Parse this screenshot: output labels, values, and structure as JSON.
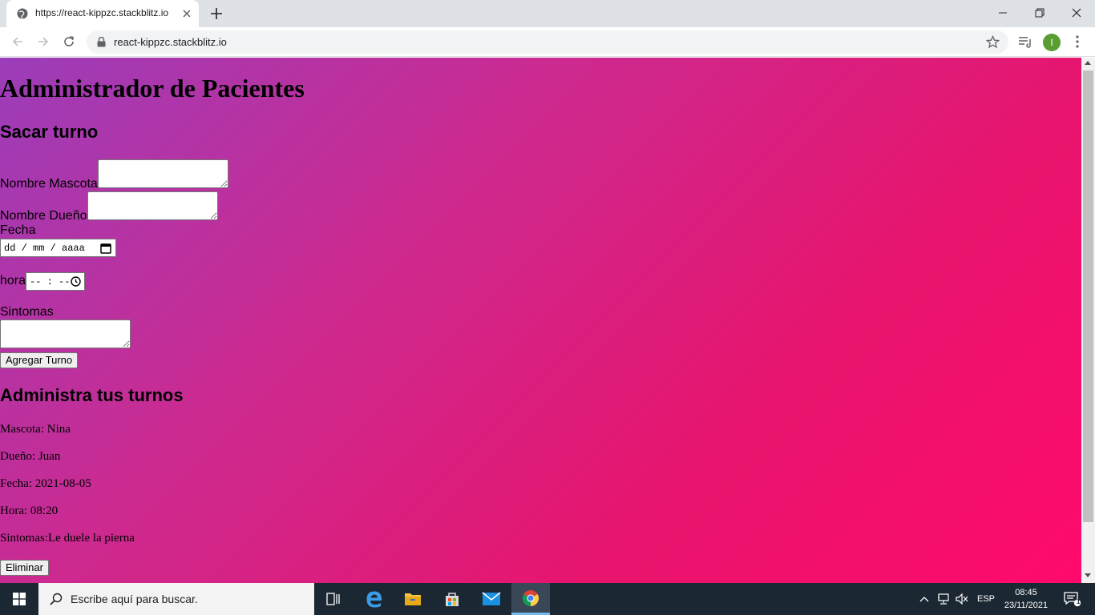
{
  "browser": {
    "tab_title": "https://react-kippzc.stackblitz.io",
    "url": "react-kippzc.stackblitz.io",
    "profile_initial": "I"
  },
  "page": {
    "title": "Administrador de Pacientes",
    "form_heading": "Sacar turno",
    "labels": {
      "pet_name": "Nombre Mascota",
      "owner_name": "Nombre Dueño",
      "date": "Fecha",
      "time": "hora",
      "symptoms": "Sintomas"
    },
    "date_placeholder": "dd / mm / aaaa",
    "time_placeholder": "-- : --",
    "add_button": "Agregar Turno",
    "list_heading": "Administra tus turnos",
    "appointments": [
      {
        "pet": "Mascota: Nina",
        "owner": "Dueño: Juan",
        "date": "Fecha: 2021-08-05",
        "time": "Hora: 08:20",
        "symptoms": "Sintomas:Le duele la pierna",
        "delete_button": "Eliminar"
      }
    ]
  },
  "taskbar": {
    "search_placeholder": "Escribe aquí para buscar.",
    "language": "ESP",
    "time": "08:45",
    "date": "23/11/2021",
    "notification_count": "1"
  },
  "colors": {
    "gradient_start": "#9b3dba",
    "gradient_end": "#ff0a6c",
    "taskbar": "#1b2733"
  }
}
